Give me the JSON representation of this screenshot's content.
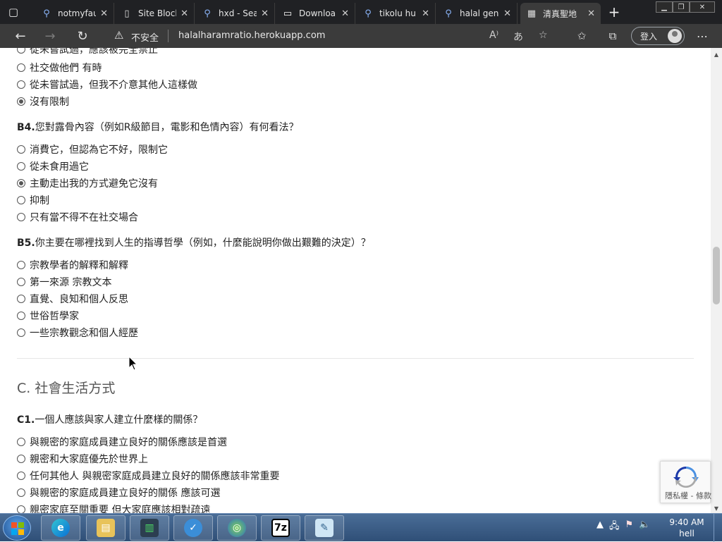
{
  "browser": {
    "tabs": [
      {
        "label": "notmyfau",
        "icon": "search-icon"
      },
      {
        "label": "Site Block",
        "icon": "page-icon"
      },
      {
        "label": "hxd - Sea",
        "icon": "search-icon"
      },
      {
        "label": "Downloa",
        "icon": "download-site-icon"
      },
      {
        "label": "tikolu hu",
        "icon": "search-icon"
      },
      {
        "label": "halal gen",
        "icon": "search-icon"
      },
      {
        "label": "清真聖地",
        "icon": "calculator-icon",
        "active": true
      }
    ],
    "address": {
      "security_label": "不安全",
      "url": "halalharamratio.herokuapp.com"
    },
    "signin_label": "登入"
  },
  "page": {
    "top_partial_option": "從未嘗試過，應該被完全禁止",
    "b3_options": [
      {
        "label": "社交做他們 有時",
        "checked": false
      },
      {
        "label": "從未嘗試過，但我不介意其他人這樣做",
        "checked": false
      },
      {
        "label": "沒有限制",
        "checked": true
      }
    ],
    "b4": {
      "number": "B4.",
      "text": "您對露骨內容（例如R級節目，電影和色情內容）有何看法？",
      "options": [
        {
          "label": "消費它，但認為它不好，限制它",
          "checked": false
        },
        {
          "label": "從未食用過它",
          "checked": false
        },
        {
          "label": "主動走出我的方式避免它沒有",
          "checked": true
        },
        {
          "label": "抑制",
          "checked": false
        },
        {
          "label": "只有當不得不在社交場合",
          "checked": false
        }
      ]
    },
    "b5": {
      "number": "B5.",
      "text": "你主要在哪裡找到人生的指導哲學（例如，什麼能說明你做出艱難的決定）？",
      "options": [
        {
          "label": "宗教學者的解釋和解釋",
          "checked": false
        },
        {
          "label": "第一來源 宗教文本",
          "checked": false
        },
        {
          "label": "直覺、良知和個人反思",
          "checked": false
        },
        {
          "label": "世俗哲學家",
          "checked": false
        },
        {
          "label": "一些宗教觀念和個人經歷",
          "checked": false
        }
      ]
    },
    "section_c_title": "C. 社會生活方式",
    "c1": {
      "number": "C1.",
      "text": "一個人應該與家人建立什麼樣的關係？",
      "options": [
        {
          "label": "與親密的家庭成員建立良好的關係應該是首選",
          "checked": false
        },
        {
          "label": "親密和大家庭優先於世界上",
          "checked": false
        },
        {
          "label": "任何其他人 與親密家庭成員建立良好的關係應該非常重要",
          "checked": false
        },
        {
          "label": "與親密的家庭成員建立良好的關係 應該可選",
          "checked": false
        },
        {
          "label": "親密家庭至關重要 但大家庭應該相對疏遠",
          "checked": false
        }
      ]
    },
    "recaptcha_terms": "隱私權 - 條款"
  },
  "taskbar": {
    "apps": [
      "edge-icon",
      "file-explorer-icon",
      "network-monitor-icon",
      "globe-task-icon",
      "globe-icon",
      "7zip-icon",
      "notepad-icon"
    ],
    "app_text_7zip": "7z",
    "clock_time": "9:40 AM",
    "clock_user": "hell"
  },
  "colors": {
    "chrome_dark": "#202124",
    "toolbar": "#3b3b3b",
    "taskbar": "#3a5c87",
    "text": "#222222"
  }
}
